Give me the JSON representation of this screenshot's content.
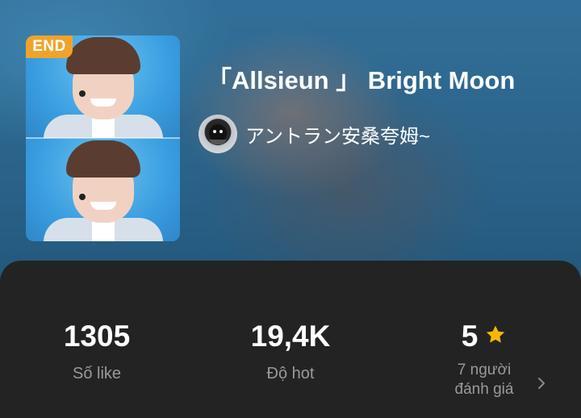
{
  "book": {
    "status_badge": "END",
    "title": "「Allsieun 」 Bright Moon",
    "author": "アントラン安桑夸姆~"
  },
  "stats": {
    "likes": {
      "value": "1305",
      "label": "Số like"
    },
    "hot": {
      "value": "19,4K",
      "label": "Độ hot"
    },
    "rating": {
      "value": "5",
      "label_line1": "7 người",
      "label_line2": "đánh giá"
    }
  },
  "colors": {
    "badge": "#f0a32a",
    "star": "#f5b800",
    "panel": "#232323",
    "label": "#9a9a9a"
  },
  "icons": [
    "star-icon",
    "chevron-right-icon"
  ]
}
